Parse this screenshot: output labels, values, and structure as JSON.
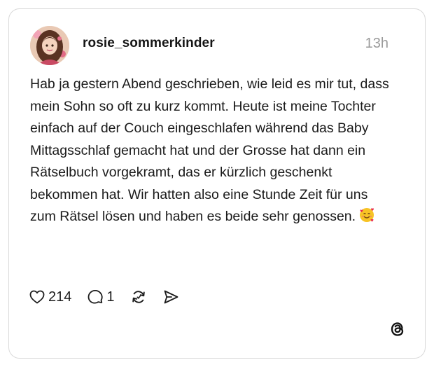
{
  "post": {
    "username": "rosie_sommerkinder",
    "timestamp": "13h",
    "text": "Hab ja gestern Abend geschrieben, wie leid es mir tut, dass mein Sohn so oft zu kurz kommt. Heute ist meine Tochter einfach auf der Couch eingeschlafen während das Baby Mittagsschlaf gemacht hat und der Grosse hat dann ein Rätselbuch vorgekramt, das er kürzlich geschenkt bekommen hat. Wir hatten also eine Stunde Zeit für uns zum Rätsel lösen und haben es beide sehr genossen.",
    "emoji": "smiling-face-with-hearts"
  },
  "actions": {
    "likes": "214",
    "replies": "1",
    "repost_icon": "repost-icon",
    "share_icon": "send-icon"
  },
  "branding": {
    "logo": "threads-logo-icon"
  },
  "colors": {
    "text": "#1a1a1a",
    "muted": "#9a9a9a",
    "border": "#d9d9d9",
    "background": "#ffffff"
  }
}
